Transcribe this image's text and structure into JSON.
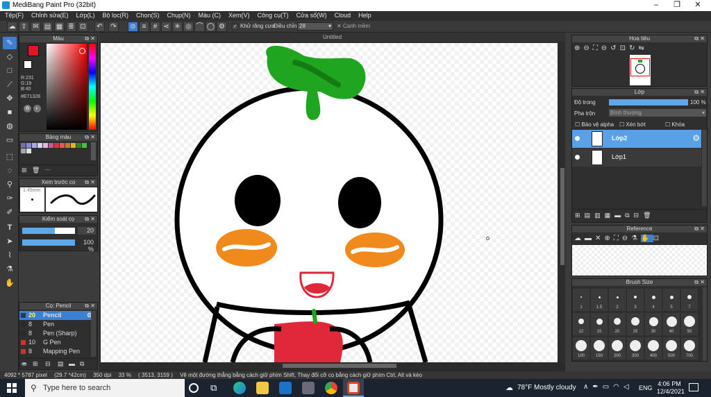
{
  "window": {
    "title": "MediBang Paint Pro (32bit)",
    "min": "–",
    "max": "❐",
    "close": "✕"
  },
  "menu": [
    "Tệp(F)",
    "Chỉnh sửa(E)",
    "Lớp(L)",
    "Bộ lọc(R)",
    "Chọn(S)",
    "Chụp(N)",
    "Màu (C)",
    "Xem(V)",
    "Công cụ(T)",
    "Cửa sổ(W)",
    "Cloud",
    "Help"
  ],
  "toolbar": {
    "antialias_label": "Khử răng cưa",
    "adjust_label": "Điều chỉnh",
    "adjust_value": "28",
    "snap_label": "Canh mềm"
  },
  "document": {
    "title": "Untitled"
  },
  "color_panel": {
    "title": "Màu",
    "r": "R:231",
    "g": "G:19",
    "b": "B:40",
    "hex": "#E71328",
    "primary": "#E71328",
    "secondary": "#ffffff"
  },
  "palette_panel": {
    "title": "Bảng màu",
    "dash": "---",
    "colors": [
      "#6f6fae",
      "#8a8ad2",
      "#a9a9e6",
      "#d7d7f5",
      "#e6b7d7",
      "#c45aa0",
      "#d23a3a",
      "#e05a5a",
      "#c77c2a",
      "#e0b32a",
      "#2a8a2a",
      "#4ab84a",
      "#a7a7a7",
      "#e0e0e0"
    ]
  },
  "brush_preview": {
    "title": "Xem trước cọ",
    "size": "1.45mm"
  },
  "brush_control": {
    "title": "Kiểm soát cọ",
    "size": "20",
    "opacity": "100 %",
    "size_pct": 62,
    "opacity_pct": 100
  },
  "brush_list": {
    "title": "Cọ: Pencil",
    "items": [
      {
        "n": "20",
        "name": "Pencil",
        "color": "#1f3a66"
      },
      {
        "n": "8",
        "name": "Pen",
        "color": "#2a2a2a"
      },
      {
        "n": "8",
        "name": "Pen (Sharp)",
        "color": "#2a2a2a"
      },
      {
        "n": "10",
        "name": "G Pen",
        "color": "#d23030"
      },
      {
        "n": "8",
        "name": "Mapping Pen",
        "color": "#d23030"
      }
    ]
  },
  "navigator": {
    "title": "Hoa tiêu"
  },
  "layer_panel": {
    "title": "Lớp",
    "opacity_label": "Độ trong",
    "opacity_value": "100 %",
    "opacity_pct": 100,
    "blend_label": "Pha trộn",
    "blend_value": "Bình thường",
    "protect_alpha": "Bảo vệ alpha",
    "clipping": "Xén bớt",
    "lock": "Khóa",
    "layers": [
      {
        "name": "Lớp2",
        "selected": true
      },
      {
        "name": "Lớp1",
        "selected": false
      }
    ]
  },
  "reference": {
    "title": "Reference"
  },
  "brush_size": {
    "title": "Brush Size",
    "sizes": [
      "1",
      "1.5",
      "2",
      "3",
      "4",
      "5",
      "7",
      "12",
      "15",
      "20",
      "25",
      "30",
      "40",
      "50",
      "100",
      "150",
      "200",
      "300",
      "400",
      "500",
      "700"
    ]
  },
  "status": {
    "pixels": "4092 * 5787 pixel",
    "size": "(29.7 *42cm)",
    "dpi": "350 dpi",
    "zoom": "33 %",
    "coords": "( 3513, 3159 )",
    "hint": "Vẽ một đường thẳng bằng cách giữ phím Shift, Thay đổi cỡ cọ bằng cách giữ phím Ctrl, Alt và kéo"
  },
  "taskbar": {
    "search": "Type here to search",
    "weather": "78°F  Mostly cloudy",
    "lang": "ENG",
    "time": "4:06 PM",
    "date": "12/4/2021"
  }
}
